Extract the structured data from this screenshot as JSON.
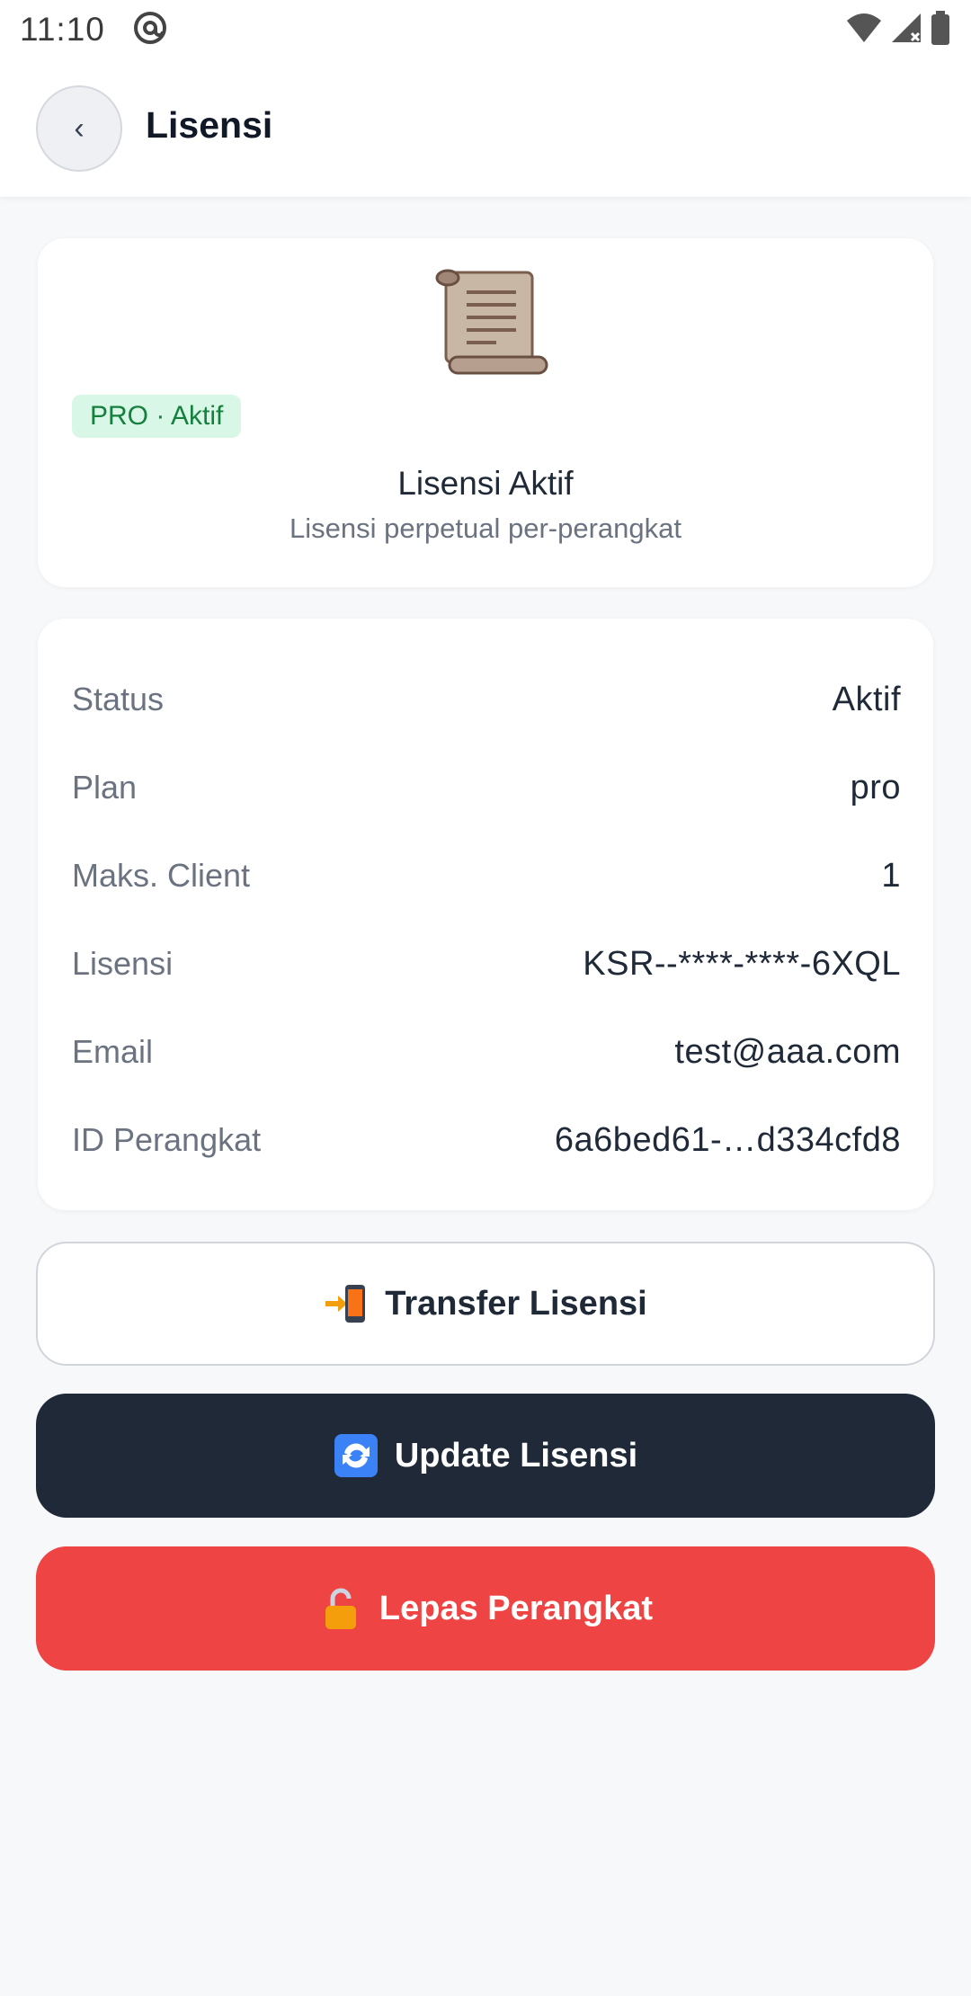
{
  "status_bar": {
    "time": "11:10",
    "icons": [
      "at-sign-icon",
      "wifi-icon",
      "signal-icon",
      "battery-icon"
    ]
  },
  "app_bar": {
    "back_label": "‹",
    "title": "Lisensi"
  },
  "hero": {
    "icon": "scroll-icon",
    "badge": "PRO · Aktif",
    "title": "Lisensi Aktif",
    "subtitle": "Lisensi perpetual per-perangkat"
  },
  "info": {
    "rows": [
      {
        "label": "Status",
        "value": "Aktif"
      },
      {
        "label": "Plan",
        "value": "pro"
      },
      {
        "label": "Maks. Client",
        "value": "1"
      },
      {
        "label": "Lisensi",
        "value": "KSR--****-****-6XQL"
      },
      {
        "label": "Email",
        "value": "test@aaa.com"
      },
      {
        "label": "ID Perangkat",
        "value": "6a6bed61-…d334cfd8"
      }
    ]
  },
  "actions": {
    "transfer": {
      "label": "Transfer Lisensi",
      "icon": "phone-transfer-icon"
    },
    "update": {
      "label": "Update Lisensi",
      "icon": "refresh-icon"
    },
    "release": {
      "label": "Lepas Perangkat",
      "icon": "unlock-icon"
    }
  },
  "colors": {
    "badge_bg": "#d9f7e6",
    "badge_text": "#15803d",
    "dark_button": "#1f2937",
    "danger_button": "#ef4444",
    "page_bg": "#f7f8fa"
  }
}
